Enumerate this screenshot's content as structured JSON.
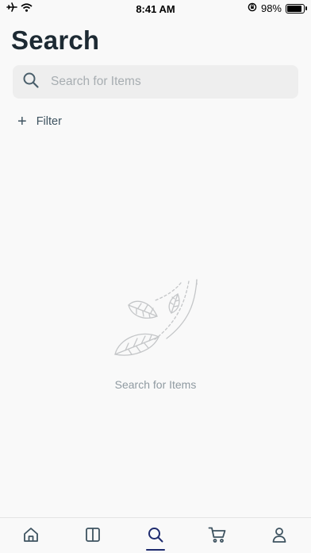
{
  "status_bar": {
    "time": "8:41 AM",
    "battery": "98%",
    "battery_level": 0.98,
    "icons": [
      "airplane-icon",
      "wifi-icon",
      "rotation-lock-icon",
      "battery-icon"
    ]
  },
  "page": {
    "title": "Search"
  },
  "search": {
    "placeholder": "Search for Items",
    "value": ""
  },
  "filter": {
    "label": "Filter"
  },
  "empty_state": {
    "message": "Search for Items",
    "icon": "falling-leaves-icon"
  },
  "tab_bar": {
    "tabs": [
      {
        "name": "home",
        "icon": "home-icon",
        "active": false
      },
      {
        "name": "browse",
        "icon": "book-icon",
        "active": false
      },
      {
        "name": "search",
        "icon": "search-icon",
        "active": true
      },
      {
        "name": "cart",
        "icon": "cart-icon",
        "active": false
      },
      {
        "name": "account",
        "icon": "user-icon",
        "active": false
      }
    ],
    "active_color": "#1e2b6e",
    "inactive_color": "#3e5360"
  }
}
